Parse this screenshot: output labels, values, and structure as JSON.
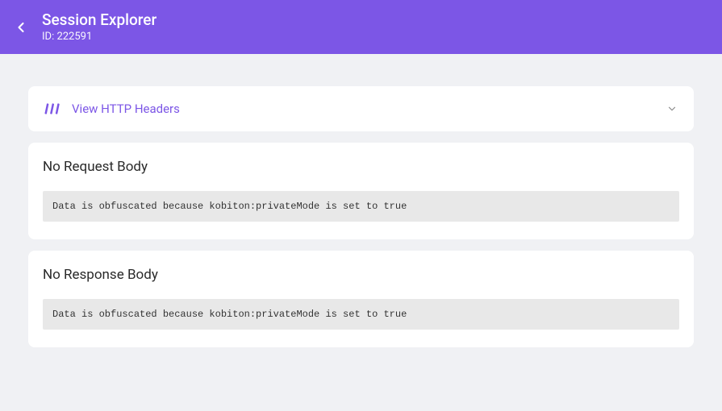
{
  "header": {
    "title": "Session Explorer",
    "subtitle": "ID: 222591"
  },
  "expand_panel": {
    "label": "View HTTP Headers"
  },
  "request_body": {
    "title": "No Request Body",
    "message": "Data is obfuscated because kobiton:privateMode is set to true"
  },
  "response_body": {
    "title": "No Response Body",
    "message": "Data is obfuscated because kobiton:privateMode is set to true"
  },
  "colors": {
    "accent": "#7c56e6",
    "background": "#f0f1f4"
  }
}
